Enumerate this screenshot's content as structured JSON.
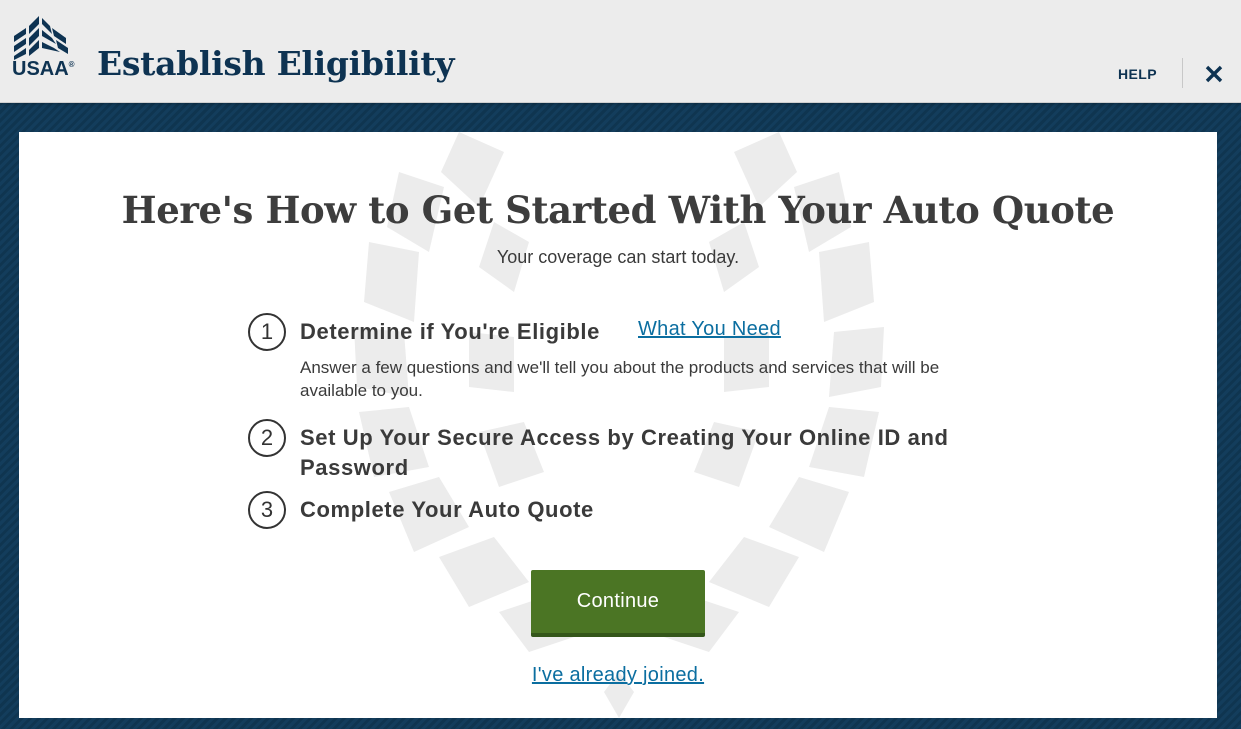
{
  "header": {
    "logo_text": "USAA",
    "logo_reg": "®",
    "title": "Establish Eligibility",
    "help_label": "HELP"
  },
  "main": {
    "title": "Here's How to Get Started With Your Auto Quote",
    "subtitle": "Your coverage can start today.",
    "steps": [
      {
        "number": "1",
        "title": "Determine if You're Eligible",
        "link": "What You Need",
        "description": "Answer a few questions and we'll tell you about the products and services that will be available to you."
      },
      {
        "number": "2",
        "title": "Set Up Your Secure Access by Creating Your Online ID and Password"
      },
      {
        "number": "3",
        "title": "Complete Your Auto Quote"
      }
    ],
    "continue_label": "Continue",
    "joined_link": "I've already joined."
  },
  "icons": {
    "close": "close-icon",
    "logo": "usaa-eagle-logo",
    "background": "laurel-wreath-watermark"
  },
  "colors": {
    "navy": "#0e3352",
    "button_green": "#4b7524",
    "link_blue": "#0b6ea0"
  }
}
